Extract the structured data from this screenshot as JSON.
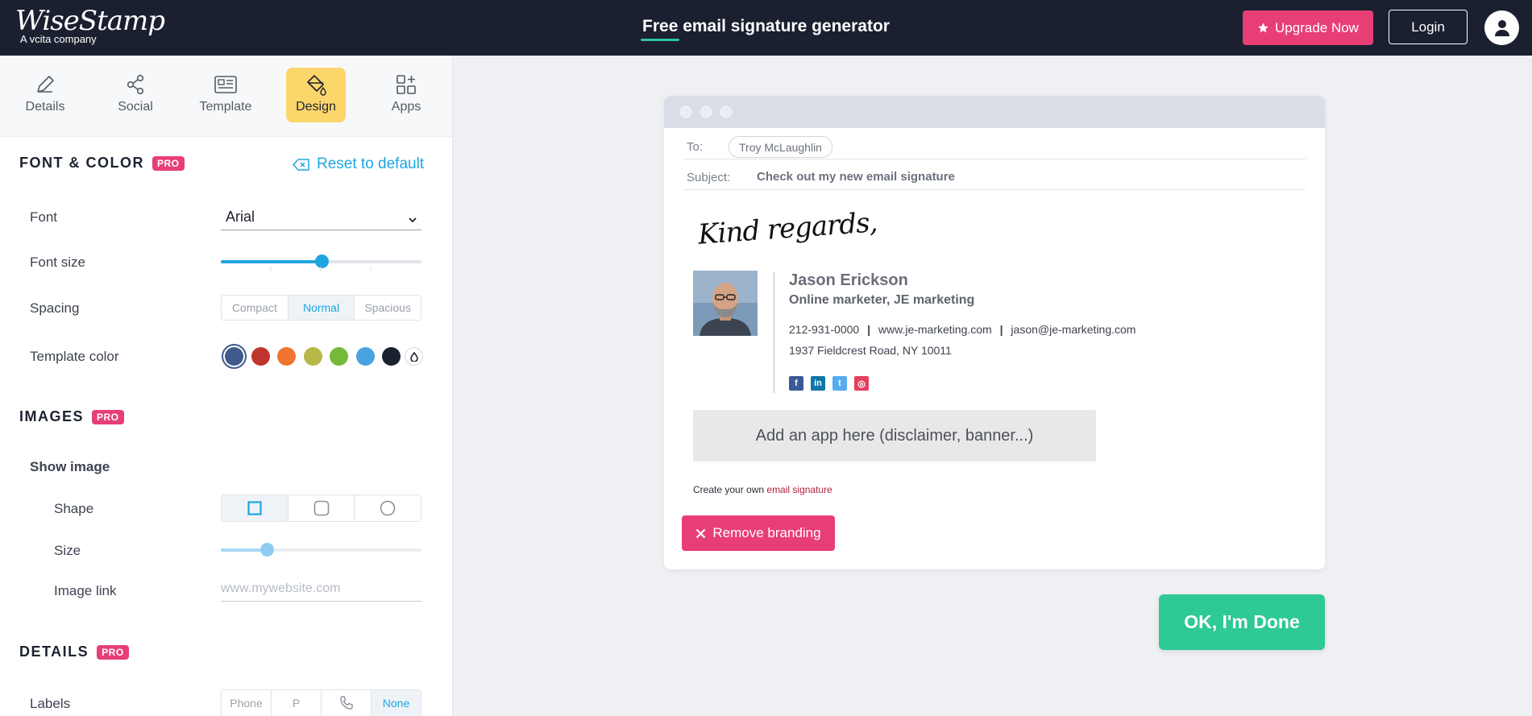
{
  "brand": {
    "name": "WiseStamp",
    "tagline": "A vcita company"
  },
  "header": {
    "headline_highlight": "Free",
    "headline_rest": " email signature generator",
    "upgrade_label": "Upgrade Now",
    "login_label": "Login"
  },
  "tabs": [
    {
      "label": "Details",
      "icon": "pencil-icon"
    },
    {
      "label": "Social",
      "icon": "share-icon"
    },
    {
      "label": "Template",
      "icon": "template-icon"
    },
    {
      "label": "Design",
      "icon": "paint-bucket-icon",
      "active": true
    },
    {
      "label": "Apps",
      "icon": "apps-grid-icon"
    }
  ],
  "font_color": {
    "title": "FONT & COLOR",
    "pro": "PRO",
    "reset_label": "Reset to default",
    "font_label": "Font",
    "font_value": "Arial",
    "font_size_label": "Font size",
    "font_size_level": 0.5,
    "spacing_label": "Spacing",
    "spacing_options": [
      "Compact",
      "Normal",
      "Spacious"
    ],
    "spacing_selected": "Normal",
    "template_color_label": "Template color",
    "colors": [
      "#3f5a8c",
      "#c0342f",
      "#ee7430",
      "#b8b84a",
      "#76b93b",
      "#4aa3e0",
      "#1b2030"
    ],
    "selected_color": "#3f5a8c"
  },
  "images": {
    "title": "IMAGES",
    "pro": "PRO",
    "show_image_label": "Show image",
    "shape_label": "Shape",
    "shapes": [
      "square",
      "rounded",
      "circle"
    ],
    "shape_selected": "square",
    "size_label": "Size",
    "size_level": 0.23,
    "image_link_label": "Image link",
    "image_link_placeholder": "www.mywebsite.com"
  },
  "details": {
    "title": "DETAILS",
    "pro": "PRO",
    "labels_label": "Labels",
    "label_options": [
      "Phone",
      "P",
      "phone-icon",
      "None"
    ],
    "label_selected": "None"
  },
  "email": {
    "to_label": "To:",
    "to_value": "Troy McLaughlin",
    "subject_label": "Subject:",
    "subject_value": "Check out my new email signature",
    "signoff": "Kind regards,",
    "signature": {
      "name": "Jason Erickson",
      "title": "Online marketer, JE marketing",
      "phone": "212-931-0000",
      "website": "www.je-marketing.com",
      "email": "jason@je-marketing.com",
      "separator": "|",
      "address": "1937 Fieldcrest Road, NY 10011",
      "social": [
        {
          "icon": "facebook-icon",
          "glyph": "f",
          "color": "#3b5998"
        },
        {
          "icon": "linkedin-icon",
          "glyph": "in",
          "color": "#0e76a8"
        },
        {
          "icon": "twitter-icon",
          "glyph": "t",
          "color": "#55acee"
        },
        {
          "icon": "instagram-icon",
          "glyph": "◎",
          "color": "#e4405f"
        }
      ]
    },
    "app_placeholder": "Add an app here (disclaimer, banner...)",
    "credit_prefix": "Create your own ",
    "credit_link": "email signature",
    "remove_branding_label": "Remove branding"
  },
  "done_label": "OK, I'm Done"
}
